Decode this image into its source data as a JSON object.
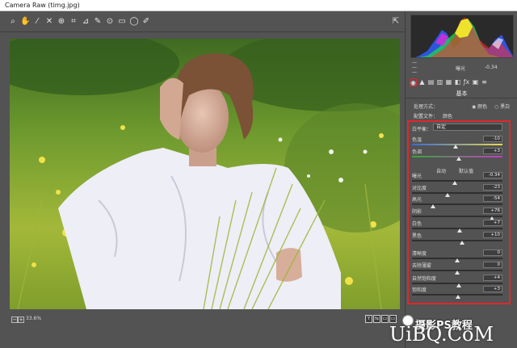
{
  "window": {
    "title": "Camera Raw (timg.jpg)"
  },
  "toolbar": {
    "tools": [
      "zoom-icon",
      "hand-icon",
      "white-balance-icon",
      "color-sampler-icon",
      "targeted-adjust-icon",
      "crop-icon",
      "straighten-icon",
      "spot-removal-icon",
      "redeye-icon",
      "graduated-filter-icon",
      "radial-filter-icon",
      "adjustment-brush-icon"
    ],
    "glyphs": [
      "⌕",
      "✋",
      "⁄",
      "✕",
      "⊕",
      "⌗",
      "⊿",
      "✎",
      "⊙",
      "▭",
      "◯",
      "✐"
    ],
    "preview_toggle": "⇱"
  },
  "bottom": {
    "zoom": "33.6%",
    "buttons": [
      "Y",
      "⇆",
      "▭",
      "▭"
    ]
  },
  "histogram": {
    "exposure_label": "曝光",
    "exposure_value": "-0.34",
    "rows": [
      "—",
      "—",
      "—"
    ]
  },
  "panel": {
    "tabs": [
      "◉",
      "▲",
      "▤",
      "▥",
      "▦",
      "◧",
      "ƒx",
      "▣",
      "≡"
    ],
    "section_title": "基本",
    "treatment_label": "处理方式：",
    "treatment_color": "颜色",
    "treatment_bw": "黑白",
    "profile_label": "配置文件：",
    "profile_value": "颜色",
    "wb_label": "白平衡：",
    "wb_value": "自定",
    "auto": "自动",
    "default": "默认值",
    "sliders": [
      {
        "label": "色温",
        "value": "-10",
        "pos": 0.48
      },
      {
        "label": "色调",
        "value": "+3",
        "pos": 0.52
      },
      {
        "label": "曝光",
        "value": "-0.34",
        "pos": 0.47
      },
      {
        "label": "对比度",
        "value": "-23",
        "pos": 0.39
      },
      {
        "label": "高光",
        "value": "-54",
        "pos": 0.23
      },
      {
        "label": "阴影",
        "value": "+76",
        "pos": 0.88
      },
      {
        "label": "白色",
        "value": "+7",
        "pos": 0.53
      },
      {
        "label": "黑色",
        "value": "+10",
        "pos": 0.55
      },
      {
        "label": "清晰度",
        "value": "0",
        "pos": 0.5
      },
      {
        "label": "去除薄雾",
        "value": "0",
        "pos": 0.5
      },
      {
        "label": "自然饱和度",
        "value": "+4",
        "pos": 0.52
      },
      {
        "label": "饱和度",
        "value": "+3",
        "pos": 0.51
      }
    ]
  },
  "watermark": {
    "line1": "摄影PS教程",
    "line2": "UiBQ.CoM"
  },
  "colors": {
    "accent": "#e2262b",
    "bg": "#535353"
  }
}
